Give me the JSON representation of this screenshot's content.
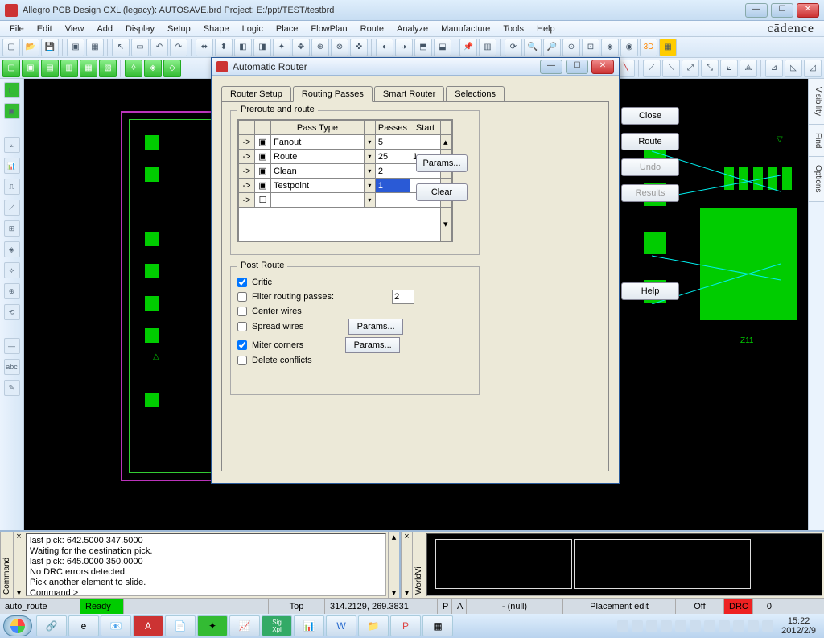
{
  "window": {
    "title": "Allegro PCB Design GXL (legacy): AUTOSAVE.brd   Project: E:/ppt/TEST/testbrd",
    "brand": "cādence"
  },
  "menu": [
    "File",
    "Edit",
    "View",
    "Add",
    "Display",
    "Setup",
    "Shape",
    "Logic",
    "Place",
    "FlowPlan",
    "Route",
    "Analyze",
    "Manufacture",
    "Tools",
    "Help"
  ],
  "dialog": {
    "title": "Automatic Router",
    "tabs": [
      "Router Setup",
      "Routing Passes",
      "Smart Router",
      "Selections"
    ],
    "active_tab": "Routing Passes",
    "preroute_legend": "Preroute and route",
    "headers": {
      "passtype": "Pass Type",
      "passes": "Passes",
      "start": "Start"
    },
    "rows": [
      {
        "type": "Fanout",
        "passes": "5",
        "start": ""
      },
      {
        "type": "Route",
        "passes": "25",
        "start": "1"
      },
      {
        "type": "Clean",
        "passes": "2",
        "start": ""
      },
      {
        "type": "Testpoint",
        "passes": "1",
        "start": "",
        "selected": true
      },
      {
        "type": "",
        "passes": "",
        "start": "",
        "empty": true
      }
    ],
    "buttons": {
      "close": "Close",
      "route": "Route",
      "undo": "Undo",
      "results": "Results",
      "help": "Help",
      "params": "Params...",
      "clear": "Clear"
    },
    "postroute_legend": "Post Route",
    "post": {
      "critic": "Critic",
      "filter": "Filter routing passes:",
      "filter_val": "2",
      "center": "Center wires",
      "spread": "Spread wires",
      "miter": "Miter corners",
      "delete": "Delete conflicts",
      "params": "Params..."
    }
  },
  "right_tabs": [
    "Visibility",
    "Find",
    "Options"
  ],
  "command_log": [
    "last pick:  642.5000  347.5000",
    "Waiting for the destination pick.",
    "last pick:  645.0000  350.0000",
    "No DRC errors detected.",
    "Pick another element to slide.",
    "Command >"
  ],
  "cmd_label": "Command",
  "world_label": "WorldVi",
  "status": {
    "mode": "auto_route",
    "ready": "Ready",
    "layer": "Top",
    "coords": "314.2129, 269.3831",
    "p": "P",
    "a": "A",
    "null": "- (null)",
    "edit": "Placement edit",
    "off": "Off",
    "drc": "DRC",
    "count": "0"
  },
  "tray": {
    "time": "15:22",
    "date": "2012/2/9"
  }
}
